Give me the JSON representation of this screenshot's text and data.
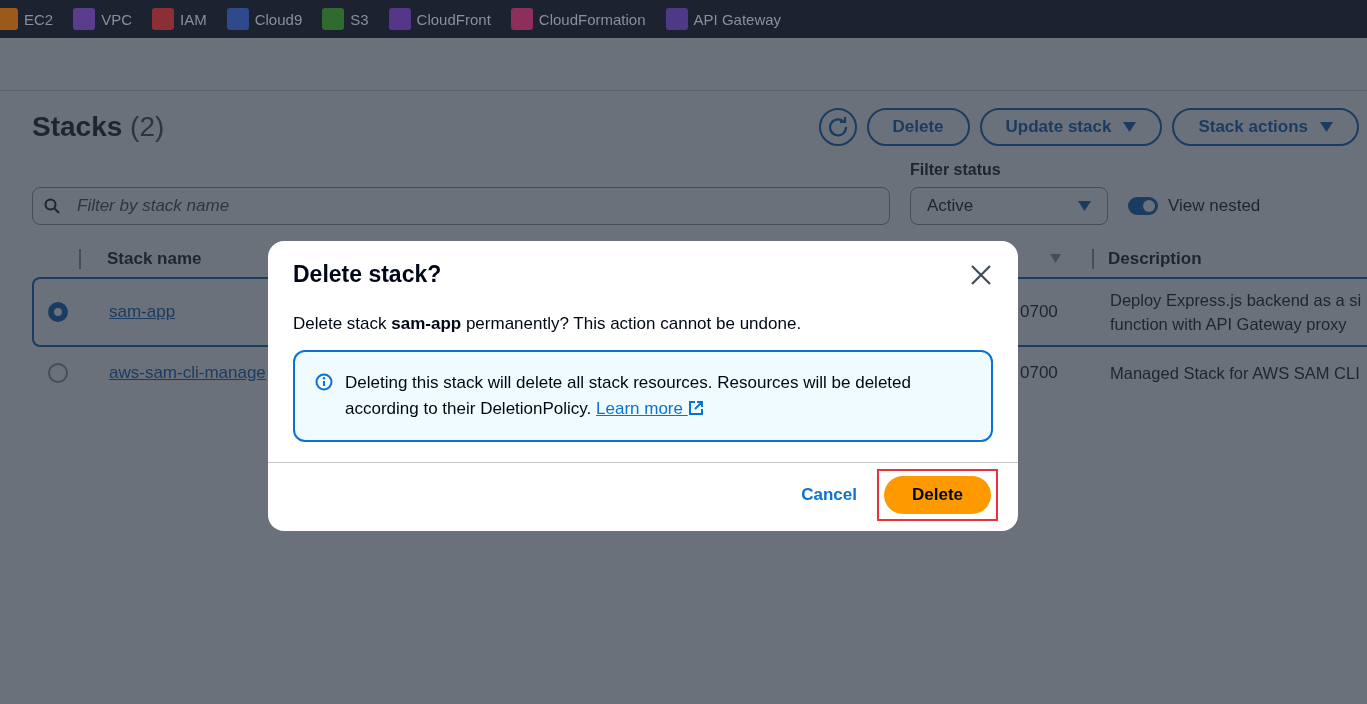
{
  "services": [
    {
      "label": "EC2",
      "color": "#9a5a1c"
    },
    {
      "label": "VPC",
      "color": "#5a3c8c"
    },
    {
      "label": "IAM",
      "color": "#8c2e36"
    },
    {
      "label": "Cloud9",
      "color": "#2f4a8c"
    },
    {
      "label": "S3",
      "color": "#2f6a2f"
    },
    {
      "label": "CloudFront",
      "color": "#55378a"
    },
    {
      "label": "CloudFormation",
      "color": "#8c2f5a"
    },
    {
      "label": "API Gateway",
      "color": "#4c3a86"
    }
  ],
  "stacks": {
    "title": "Stacks",
    "count": "(2)",
    "buttons": [
      "Delete",
      "Update stack",
      "Stack actions"
    ],
    "filter_placeholder": "Filter by stack name",
    "filter_status_label": "Filter status",
    "filter_status_value": "Active",
    "view_nested": {
      "label": "View nested",
      "on": true
    },
    "columns": [
      "Stack name",
      "Description"
    ],
    "rows": [
      {
        "name": "sam-app",
        "time": "0700",
        "description": [
          "Deploy Express.js backend as a si",
          "function with API Gateway proxy"
        ],
        "selected": true
      },
      {
        "name": "aws-sam-cli-manage",
        "time": "0700",
        "description": [
          "Managed Stack for AWS SAM CLI"
        ],
        "selected": false
      }
    ]
  },
  "dialog": {
    "title": "Delete stack?",
    "message": "Delete stack **sam-app** permanently? This action cannot be undone.",
    "alert": "Deleting this stack will delete all stack resources. Resources will be deleted according to their DeletionPolicy.",
    "alert_link": "Learn more",
    "cancel": "Cancel",
    "confirm": "Delete",
    "confirm_highlighted": true
  }
}
